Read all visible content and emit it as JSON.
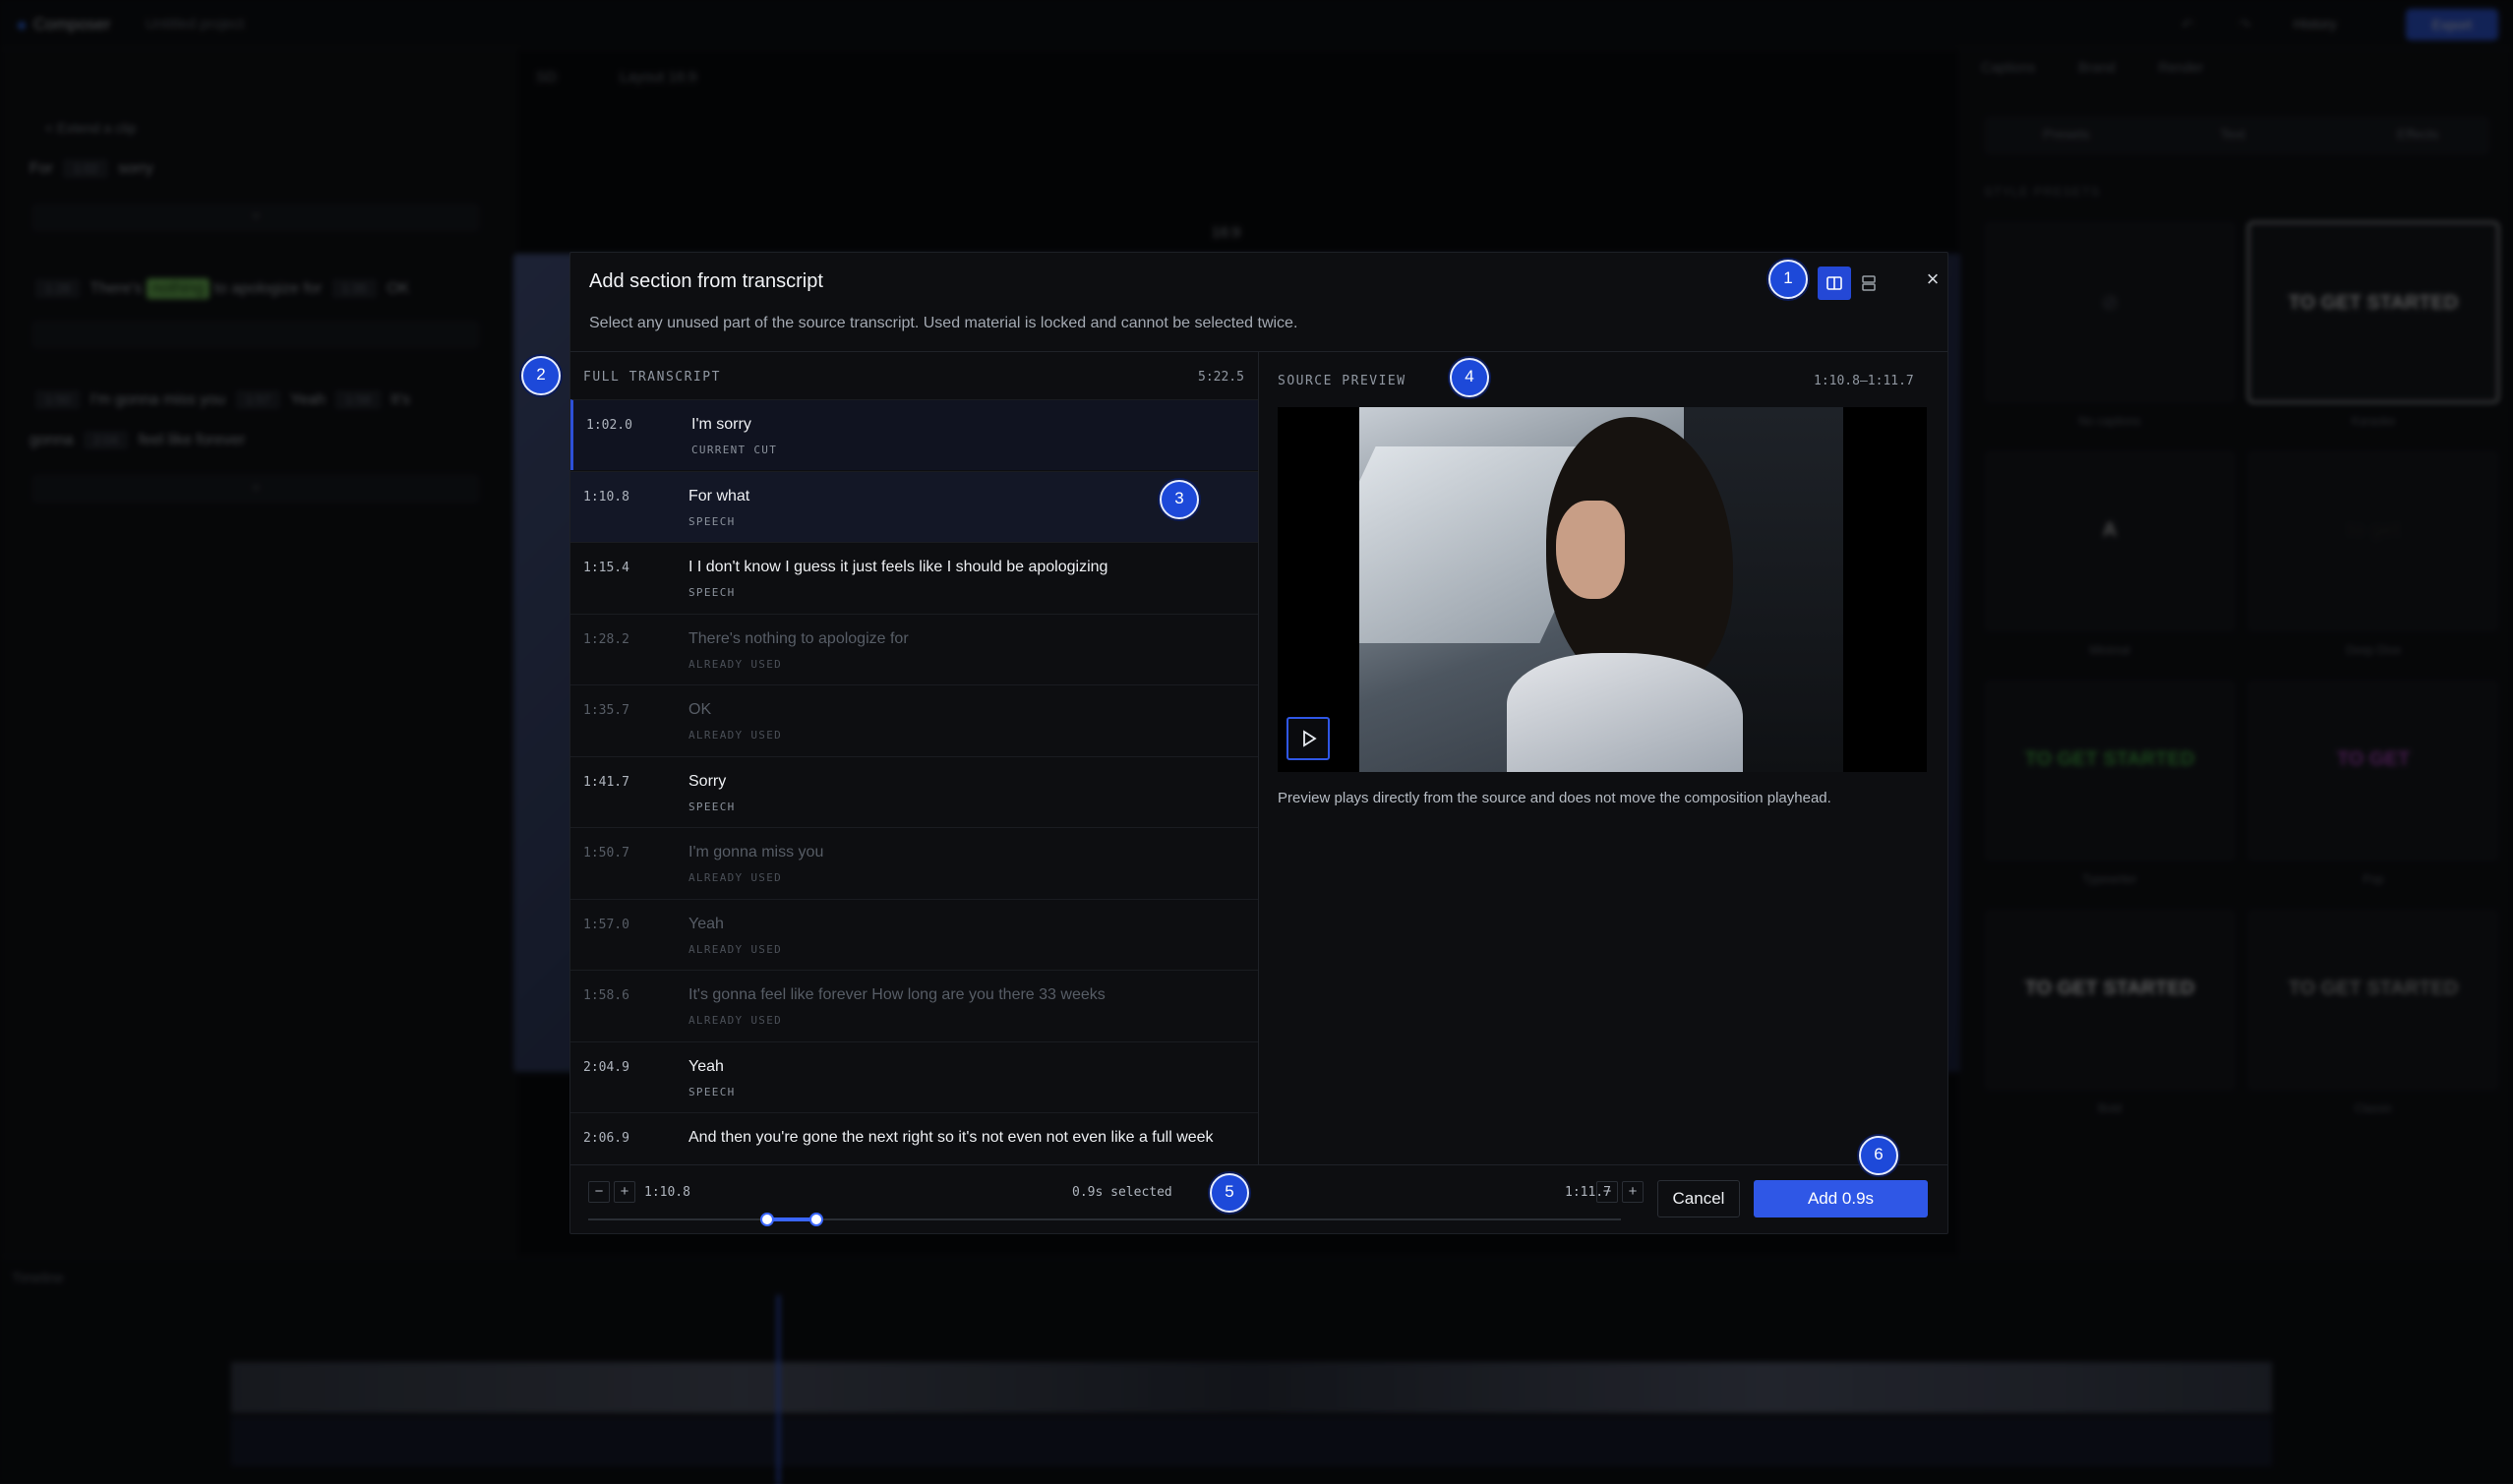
{
  "background": {
    "brand": "Composer",
    "project": "Untitled project",
    "history": "History",
    "export": "Export",
    "left": {
      "back": "< Extend a clip",
      "line1": "For",
      "chip1": "1:02",
      "line1_end": "sorry",
      "line2_pre": "There's",
      "line2_hl": "nothing",
      "line2_post": "to apologize for",
      "line2_end": "OK",
      "line3": "I'm gonna miss you",
      "line3b": "Yeah",
      "line3c": "It's",
      "line4": "gonna",
      "line4b": "feel like forever"
    },
    "center": {
      "quality": "SD",
      "layout": "Layout 16:9",
      "ratio": "16:9"
    },
    "right": {
      "tabs": [
        "Captions",
        "Brand",
        "Render"
      ],
      "seg": [
        "Presets",
        "Text",
        "Effects"
      ],
      "title": "STYLE PRESETS",
      "tiles": [
        {
          "label": "No captions",
          "text": "⊘",
          "color": "#444850"
        },
        {
          "label": "Karaoke",
          "text": "TO GET STARTED",
          "color": "#eeeeee"
        },
        {
          "label": "Minimal",
          "text": "A",
          "color": "#cccccc"
        },
        {
          "label": "Deep Dive",
          "text": "to get",
          "color": "#222222"
        },
        {
          "label": "Typewriter",
          "text": "TO GET STARTED",
          "color": "#49c24a"
        },
        {
          "label": "Pop",
          "text": "TO GET",
          "color": "#c54bd8"
        },
        {
          "label": "Bold",
          "text": "TO GET STARTED",
          "color": "#ffffff"
        },
        {
          "label": "Classic",
          "text": "TO GET STARTED",
          "color": "#aaaaaa"
        }
      ]
    },
    "timeline": {
      "label": "Timeline"
    }
  },
  "dialog": {
    "title": "Add section from transcript",
    "subtitle": "Select any unused part of the source transcript. Used material is locked and cannot be selected twice.",
    "close": "×",
    "transcript_header": "FULL TRANSCRIPT",
    "transcript_duration": "5:22.5",
    "preview_header": "SOURCE PREVIEW",
    "preview_range": "1:10.8–1:11.7",
    "preview_note": "Preview plays directly from the source and does not move the composition playhead.",
    "rows": [
      {
        "time": "1:02.0",
        "text": "I'm sorry",
        "tag": "CURRENT CUT",
        "state": "current"
      },
      {
        "time": "1:10.8",
        "text": "For what",
        "tag": "SPEECH",
        "state": "selected"
      },
      {
        "time": "1:15.4",
        "text": "I I don't know I guess it just feels like I should be apologizing",
        "tag": "SPEECH",
        "state": "speech"
      },
      {
        "time": "1:28.2",
        "text": "There's nothing to apologize for",
        "tag": "ALREADY USED",
        "state": "used"
      },
      {
        "time": "1:35.7",
        "text": "OK",
        "tag": "ALREADY USED",
        "state": "used"
      },
      {
        "time": "1:41.7",
        "text": "Sorry",
        "tag": "SPEECH",
        "state": "speech"
      },
      {
        "time": "1:50.7",
        "text": "I'm gonna miss you",
        "tag": "ALREADY USED",
        "state": "used"
      },
      {
        "time": "1:57.0",
        "text": "Yeah",
        "tag": "ALREADY USED",
        "state": "used"
      },
      {
        "time": "1:58.6",
        "text": "It's gonna feel like forever How long are you there 33 weeks",
        "tag": "ALREADY USED",
        "state": "used"
      },
      {
        "time": "2:04.9",
        "text": "Yeah",
        "tag": "SPEECH",
        "state": "speech"
      },
      {
        "time": "2:06.9",
        "text": "And then you're gone the next right so it's not even not even like a full week",
        "tag": "",
        "state": "speech"
      }
    ],
    "footer": {
      "start_time": "1:10.8",
      "end_time": "1:11.7",
      "selected": "0.9s selected",
      "minus": "−",
      "plus": "+",
      "cancel": "Cancel",
      "add": "Add 0.9s"
    },
    "markers": [
      "1",
      "2",
      "3",
      "4",
      "5",
      "6"
    ]
  }
}
